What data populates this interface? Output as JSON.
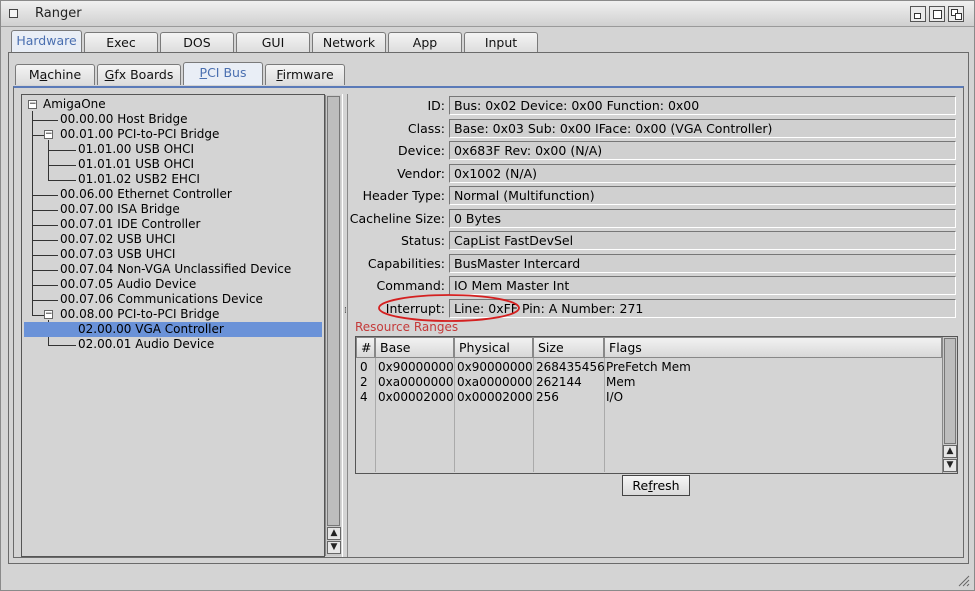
{
  "window": {
    "title": "Ranger"
  },
  "main_tabs": [
    {
      "label": "Hardware",
      "active": true
    },
    {
      "label": "Exec",
      "active": false
    },
    {
      "label": "DOS",
      "active": false
    },
    {
      "label": "GUI",
      "active": false
    },
    {
      "label": "Network",
      "active": false
    },
    {
      "label": "App",
      "active": false
    },
    {
      "label": "Input",
      "active": false
    }
  ],
  "sub_tabs": [
    {
      "pre": "M",
      "u": "a",
      "post": "chine",
      "active": false
    },
    {
      "pre": "",
      "u": "G",
      "post": "fx Boards",
      "active": false
    },
    {
      "pre": "",
      "u": "P",
      "post": "CI Bus",
      "active": true
    },
    {
      "pre": "",
      "u": "F",
      "post": "irmware",
      "active": false
    }
  ],
  "tree": {
    "root": "AmigaOne",
    "items": [
      "00.00.00 Host Bridge",
      "00.01.00 PCI-to-PCI Bridge",
      "01.01.00 USB OHCI",
      "01.01.01 USB OHCI",
      "01.01.02 USB2 EHCI",
      "00.06.00 Ethernet Controller",
      "00.07.00 ISA Bridge",
      "00.07.01 IDE Controller",
      "00.07.02 USB UHCI",
      "00.07.03 USB UHCI",
      "00.07.04 Non-VGA Unclassified Device",
      "00.07.05 Audio Device",
      "00.07.06 Communications Device",
      "00.08.00 PCI-to-PCI Bridge",
      "02.00.00 VGA Controller",
      "02.00.01 Audio Device"
    ]
  },
  "details": [
    {
      "label": "ID:",
      "value": "Bus: 0x02 Device: 0x00 Function: 0x00"
    },
    {
      "label": "Class:",
      "value": "Base: 0x03 Sub: 0x00 IFace: 0x00 (VGA Controller)"
    },
    {
      "label": "Device:",
      "value": "0x683F Rev: 0x00 (N/A)"
    },
    {
      "label": "Vendor:",
      "value": "0x1002 (N/A)"
    },
    {
      "label": "Header Type:",
      "value": "Normal (Multifunction)"
    },
    {
      "label": "Cacheline Size:",
      "value": "0 Bytes"
    },
    {
      "label": "Status:",
      "value": "CapList FastDevSel"
    },
    {
      "label": "Capabilities:",
      "value": "BusMaster Intercard"
    },
    {
      "label": "Command:",
      "value": "IO Mem Master Int"
    },
    {
      "label": "Interrupt:",
      "value": "Line: 0xFF Pin: A Number: 271"
    }
  ],
  "resource_ranges": {
    "title": "Resource Ranges",
    "columns": [
      "#",
      "Base",
      "Physical",
      "Size",
      "Flags"
    ],
    "rows": [
      [
        "0",
        "0x90000000",
        "0x90000000",
        "268435456",
        "PreFetch Mem"
      ],
      [
        "2",
        "0xa0000000",
        "0xa0000000",
        "262144",
        "Mem"
      ],
      [
        "4",
        "0x00002000",
        "0x00002000",
        "256",
        "I/O"
      ]
    ]
  },
  "refresh": {
    "pre": "Re",
    "u": "f",
    "post": "resh"
  },
  "colors": {
    "accent": "#5b86cf",
    "annotation": "#d42020",
    "section_title": "#c43a3a"
  }
}
